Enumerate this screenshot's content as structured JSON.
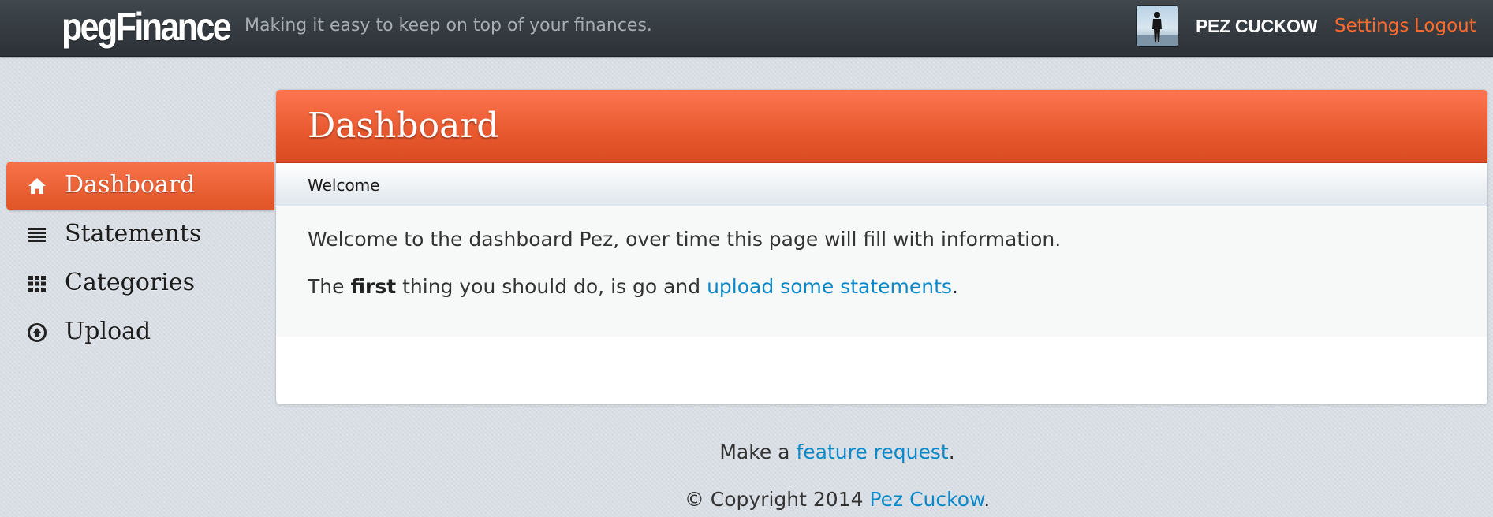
{
  "header": {
    "brand": "pegFinance",
    "tagline": "Making it easy to keep on top of your finances.",
    "user": {
      "name": "PEZ CUCKOW",
      "avatar_icon": "user-avatar-silhouette"
    },
    "links": {
      "settings": "Settings",
      "logout": "Logout"
    },
    "accent_color": "#ff6a2e"
  },
  "sidebar": {
    "items": [
      {
        "label": "Dashboard",
        "icon": "home-icon",
        "active": true
      },
      {
        "label": "Statements",
        "icon": "list-icon",
        "active": false
      },
      {
        "label": "Categories",
        "icon": "grid-icon",
        "active": false
      },
      {
        "label": "Upload",
        "icon": "upload-icon",
        "active": false
      }
    ]
  },
  "main": {
    "title": "Dashboard",
    "subtitle": "Welcome",
    "body": {
      "line1": "Welcome to the dashboard Pez, over time this page will fill with information.",
      "line2_before": "The ",
      "line2_bold": "first",
      "line2_middle": " thing you should do, is go and ",
      "line2_link": "upload some statements",
      "line2_after": "."
    }
  },
  "footer": {
    "line1_before": "Make a ",
    "line1_link": "feature request",
    "line1_after": ".",
    "line2_before": "© Copyright 2014 ",
    "line2_link": "Pez Cuckow",
    "line2_after": "."
  },
  "colors": {
    "primary_orange": "#e8582e",
    "link_blue": "#0a88c8",
    "navbar_dark": "#2b3136"
  }
}
